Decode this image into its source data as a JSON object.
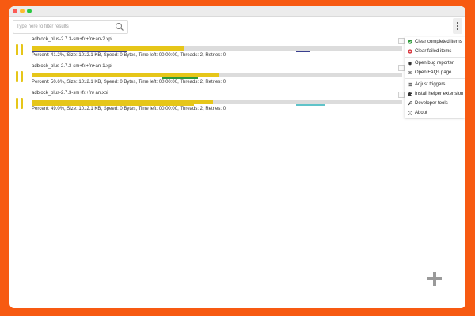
{
  "search": {
    "placeholder": "Type here to filter results"
  },
  "downloads": [
    {
      "file_name": "adblock_plus-2.7.3-sm+fx+fn+an-2.xpi",
      "percent": 41.2,
      "thread_color": "#3a3f8f",
      "stats": "Percent: 41.2%, Size: 1012.1 KB, Speed: 0 Bytes, Time left: 00:00:00, Threads: 2, Retries: 0"
    },
    {
      "file_name": "adblock_plus-2.7.3-sm+fx+fn+an-1.xpi",
      "percent": 50.6,
      "thread_color": "#2e9a3a",
      "stats": "Percent: 50.6%, Size: 1012.1 KB, Speed: 0 Bytes, Time left: 00:00:00, Threads: 2, Retries: 0"
    },
    {
      "file_name": "adblock_plus-2.7.3-sm+fx+fn+an.xpi",
      "percent": 49.0,
      "thread_color": "#5fc3c9",
      "stats": "Percent: 49.0%, Size: 1012.1 KB, Speed: 0 Bytes, Time left: 00:00:00, Threads: 2, Retries: 0"
    }
  ],
  "menu": {
    "items": [
      {
        "label": "Clear completed items",
        "icon": "check-circle-icon"
      },
      {
        "label": "Clear failed items",
        "icon": "x-circle-icon"
      },
      {
        "label": "Open bug reporter",
        "icon": "bug-icon"
      },
      {
        "label": "Open FAQs page",
        "icon": "link-icon"
      },
      {
        "label": "Adjust triggers",
        "icon": "list-icon"
      },
      {
        "label": "Install helper extension",
        "icon": "puzzle-icon"
      },
      {
        "label": "Developer tools",
        "icon": "wrench-icon"
      },
      {
        "label": "About",
        "icon": "info-icon"
      }
    ]
  },
  "colors": {
    "accent": "#e6c619",
    "background": "#f75a12",
    "track": "#dcdcdc"
  }
}
